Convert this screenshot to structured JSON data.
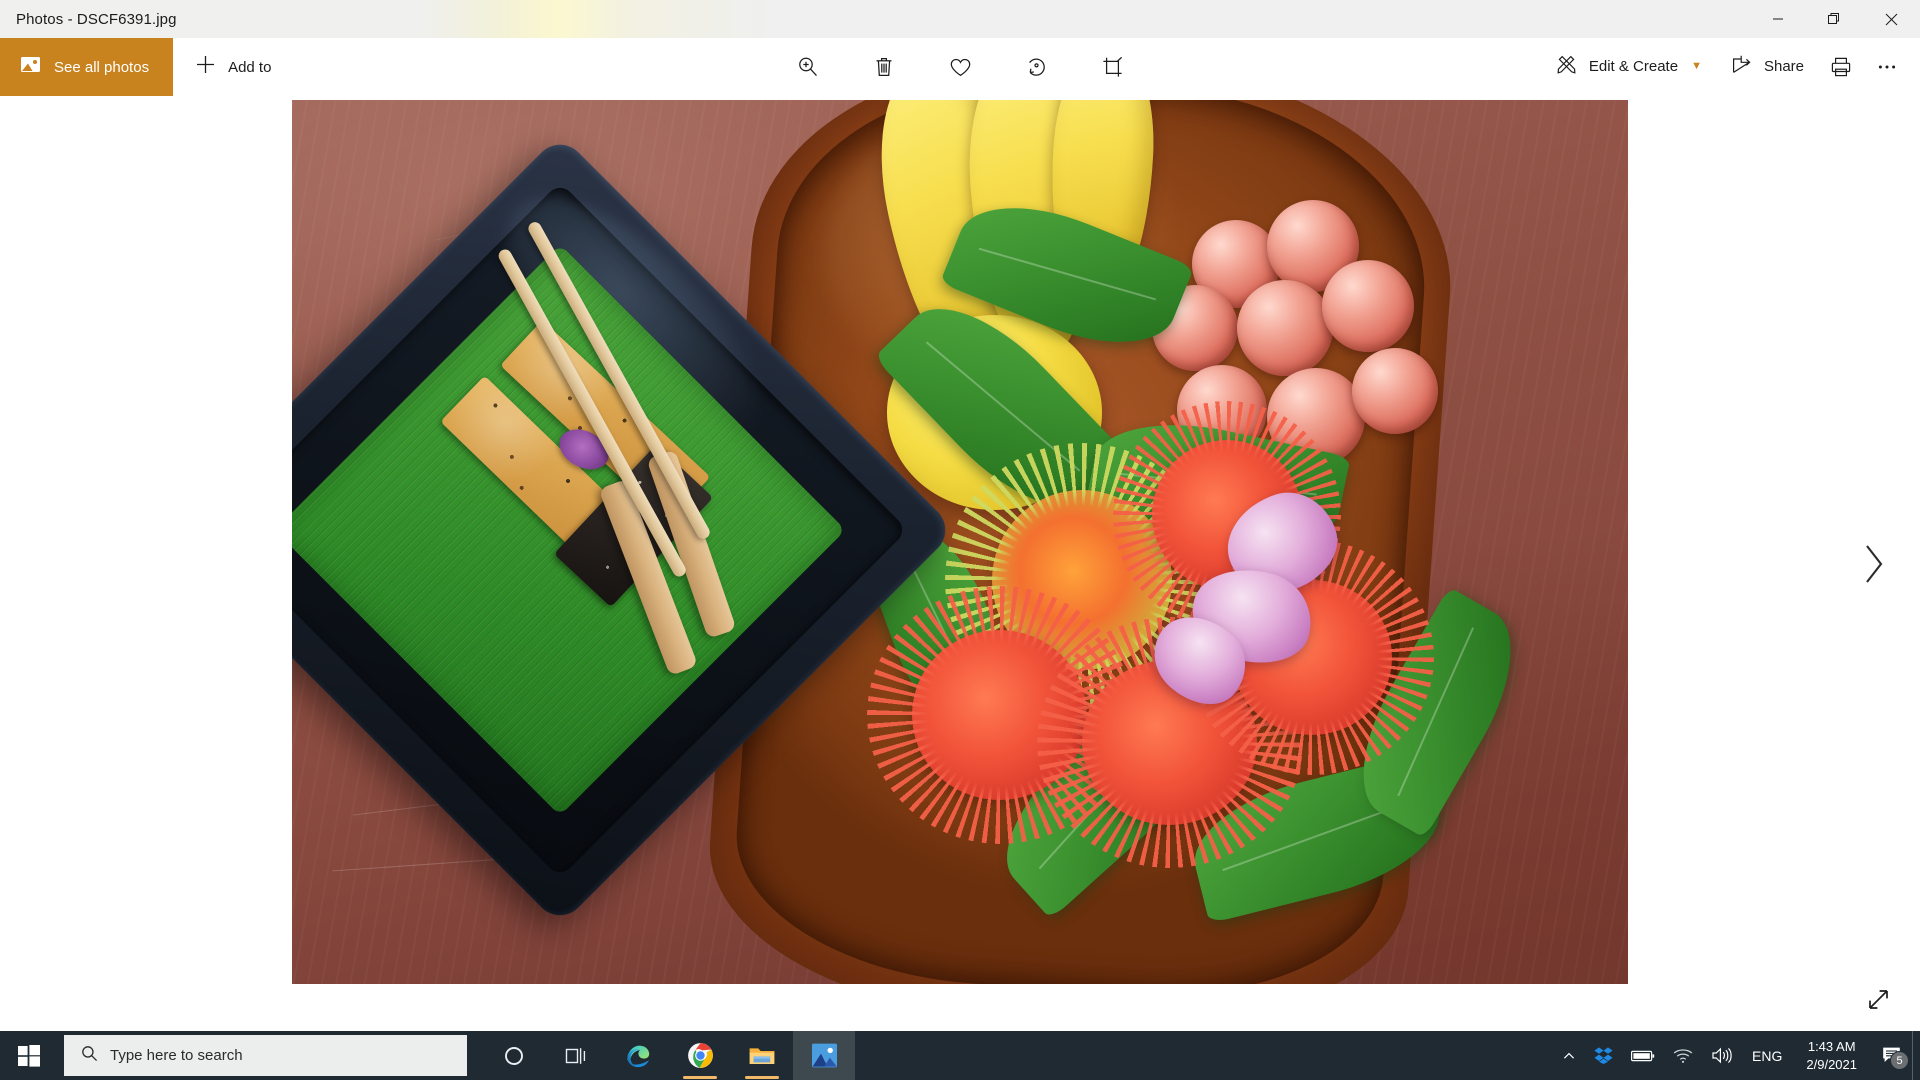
{
  "window": {
    "title": "Photos - DSCF6391.jpg",
    "controls": {
      "minimize": "minimize-button",
      "restore": "restore-button",
      "close": "close-button"
    }
  },
  "commandbar": {
    "see_all_photos": "See all photos",
    "add_to": "Add to",
    "center_tools": [
      {
        "name": "zoom-in-icon",
        "label": "Zoom"
      },
      {
        "name": "delete-icon",
        "label": "Delete"
      },
      {
        "name": "heart-icon",
        "label": "Add to favorites"
      },
      {
        "name": "rotate-icon",
        "label": "Rotate"
      },
      {
        "name": "crop-icon",
        "label": "Crop & rotate"
      }
    ],
    "edit_create": "Edit & Create",
    "share": "Share",
    "print": "print-icon",
    "more": "see-more-icon"
  },
  "viewer": {
    "next_label": "Next image",
    "fit_label": "Zoom to fit",
    "image_name": "DSCF6391.jpg",
    "image_description": "Overhead photo of a dark lacquer square plate with a green banana leaf holding nut-and-seed snack bars, sesame bar and wafer rolls, beside a wooden boat tray of bananas, a yellow citrus fruit, red grapes, rambutans, green leaves and a pink orchid on a red-brown wooden table."
  },
  "taskbar": {
    "start": "windows-start-icon",
    "search_placeholder": "Type here to search",
    "apps": [
      {
        "name": "cortana-icon",
        "label": "Cortana",
        "state": "idle"
      },
      {
        "name": "task-view-icon",
        "label": "Task View",
        "state": "idle"
      },
      {
        "name": "edge-icon",
        "label": "Microsoft Edge",
        "state": "idle"
      },
      {
        "name": "chrome-icon",
        "label": "Google Chrome",
        "state": "running"
      },
      {
        "name": "file-explorer-icon",
        "label": "File Explorer",
        "state": "running"
      },
      {
        "name": "photos-icon",
        "label": "Photos",
        "state": "active"
      }
    ],
    "tray": [
      {
        "name": "show-hidden-icons-icon",
        "label": "Show hidden icons"
      },
      {
        "name": "dropbox-icon",
        "label": "Dropbox"
      },
      {
        "name": "battery-icon",
        "label": "Battery"
      },
      {
        "name": "wifi-icon",
        "label": "Network"
      },
      {
        "name": "volume-icon",
        "label": "Volume"
      }
    ],
    "language": "ENG",
    "time": "1:43 AM",
    "date": "2/9/2021",
    "notification_count": "5"
  },
  "colors": {
    "accent_orange": "#c8821e",
    "taskbar": "#1f2a33",
    "titlebar": "#eff0ef",
    "text": "#1d1d1d"
  }
}
